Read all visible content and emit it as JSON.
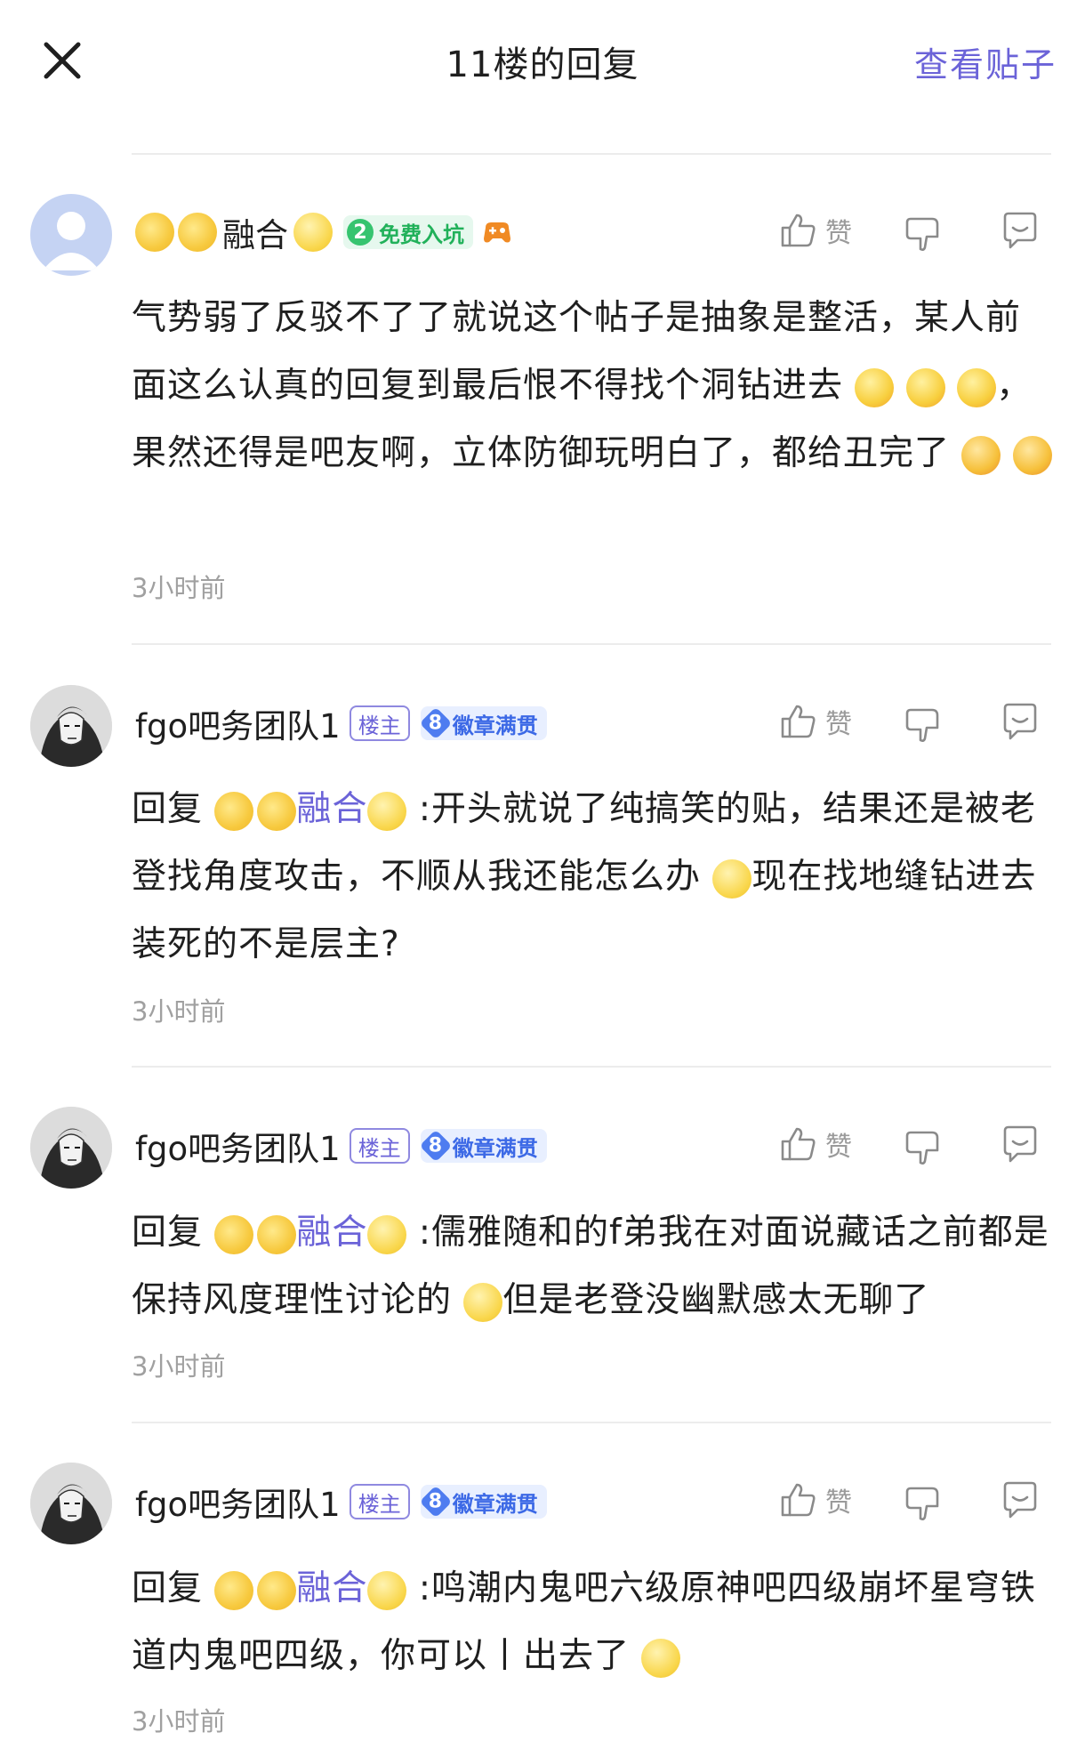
{
  "header": {
    "title": "11楼的回复",
    "view_post": "查看贴子"
  },
  "actions": {
    "like_label": "赞"
  },
  "comments": [
    {
      "user": "融合",
      "badge_level": "2",
      "badge_text": "免费入坑",
      "is_owner": false,
      "text_a": "气势弱了反驳不了了就说这个帖子是抽象是整活，某人前面这么认真的回复到最后恨不得找个洞钻进去",
      "text_b": "，果然还得是吧友啊，立体防御玩明白了，都给丑完了",
      "time": "3小时前"
    },
    {
      "user": "fgo吧务团队1",
      "owner_tag": "楼主",
      "badge_level": "8",
      "badge_text": "徽章满贯",
      "reply_prefix": "回复",
      "reply_to": "融合",
      "text_a": ":开头就说了纯搞笑的贴，结果还是被老登找角度攻击，不顺从我还能怎么办",
      "text_b": "现在找地缝钻进去装死的不是层主?",
      "time": "3小时前"
    },
    {
      "user": "fgo吧务团队1",
      "owner_tag": "楼主",
      "badge_level": "8",
      "badge_text": "徽章满贯",
      "reply_prefix": "回复",
      "reply_to": "融合",
      "text_a": ":儒雅随和的f弟我在对面说藏话之前都是保持风度理性讨论的",
      "text_b": "但是老登没幽默感太无聊了",
      "time": "3小时前"
    },
    {
      "user": "fgo吧务团队1",
      "owner_tag": "楼主",
      "badge_level": "8",
      "badge_text": "徽章满贯",
      "reply_prefix": "回复",
      "reply_to": "融合",
      "text_a": ":鸣潮内鬼吧六级原神吧四级崩坏星穹铁道内鬼吧四级，你可以丨出去了",
      "text_b": "",
      "time": "3小时前"
    }
  ]
}
